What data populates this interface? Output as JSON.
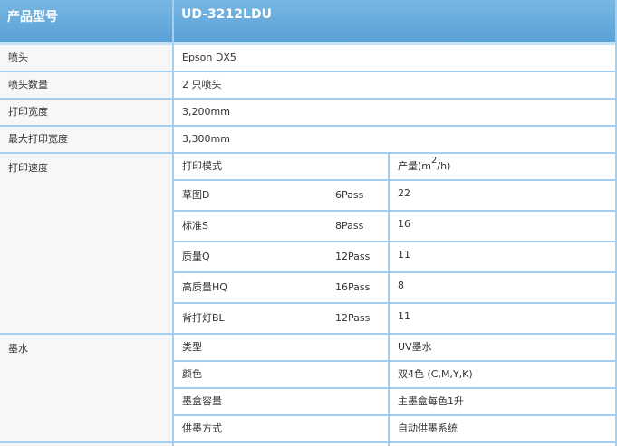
{
  "header": {
    "col1": "产品型号",
    "col2": "UD-3212LDU"
  },
  "rows": {
    "nozzle": {
      "label": "喷头",
      "value": "Epson DX5"
    },
    "nozzle_count": {
      "label": "喷头数量",
      "value": "2 只喷头"
    },
    "print_width": {
      "label": "打印宽度",
      "value": "3,200mm"
    },
    "max_print_width": {
      "label": "最大打印宽度",
      "value": "3,300mm"
    }
  },
  "speed": {
    "label": "打印速度",
    "mode_header": "打印模式",
    "output_header_prefix": "产量(m",
    "output_header_exp": "2",
    "output_header_suffix": "/h)",
    "modes": [
      {
        "name": "草图D",
        "pass": "6Pass",
        "output": "22"
      },
      {
        "name": "标准S",
        "pass": "8Pass",
        "output": "16"
      },
      {
        "name": "质量Q",
        "pass": "12Pass",
        "output": "11"
      },
      {
        "name": "高质量HQ",
        "pass": "16Pass",
        "output": "8"
      },
      {
        "name": "背打灯BL",
        "pass": "12Pass",
        "output": "11"
      }
    ]
  },
  "ink": {
    "label": "墨水",
    "items": [
      {
        "name": "类型",
        "value": "UV墨水"
      },
      {
        "name": "颜色",
        "value": "双4色 (C,M,Y,K)"
      },
      {
        "name": "墨盒容量",
        "value": "主墨盒每色1升"
      },
      {
        "name": "供墨方式",
        "value": "自动供墨系统"
      }
    ]
  }
}
